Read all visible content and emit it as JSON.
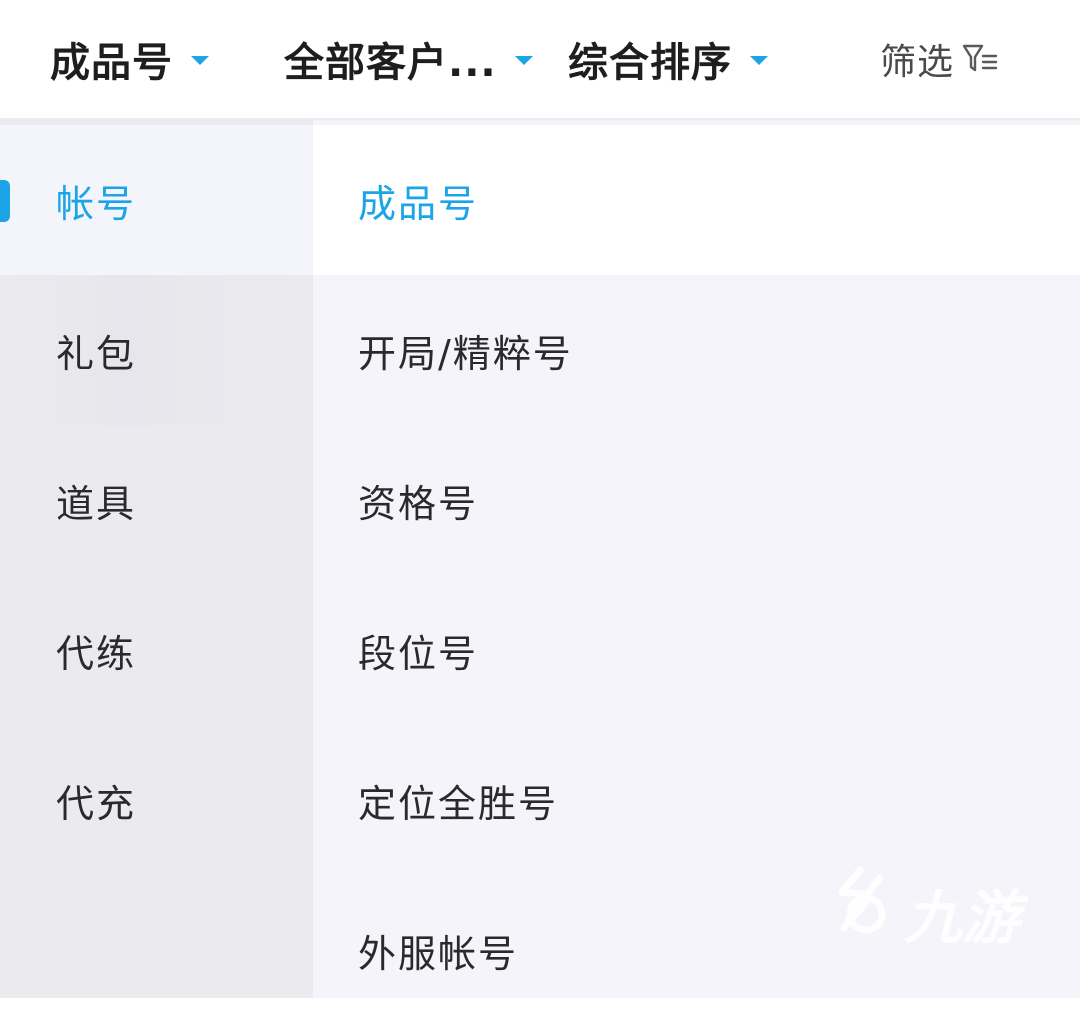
{
  "filter_bar": {
    "product_type": "成品号",
    "customer": "全部客户...",
    "sort": "综合排序",
    "filter": "筛选",
    "caret_color": "#1BA4E6"
  },
  "categories": [
    {
      "label": "帐号",
      "active": true
    },
    {
      "label": "礼包",
      "active": false
    },
    {
      "label": "道具",
      "active": false
    },
    {
      "label": "代练",
      "active": false
    },
    {
      "label": "代充",
      "active": false
    }
  ],
  "subcategories": [
    {
      "label": "成品号",
      "active": true
    },
    {
      "label": "开局/精粹号",
      "active": false
    },
    {
      "label": "资格号",
      "active": false
    },
    {
      "label": "段位号",
      "active": false
    },
    {
      "label": "定位全胜号",
      "active": false
    },
    {
      "label": "外服帐号",
      "active": false
    }
  ],
  "watermark": {
    "text": "九游"
  },
  "colors": {
    "accent": "#1BA4E6",
    "left_bg": "#EBEBEF",
    "right_bg": "#F4F4FA",
    "text": "#2A2A2A"
  }
}
